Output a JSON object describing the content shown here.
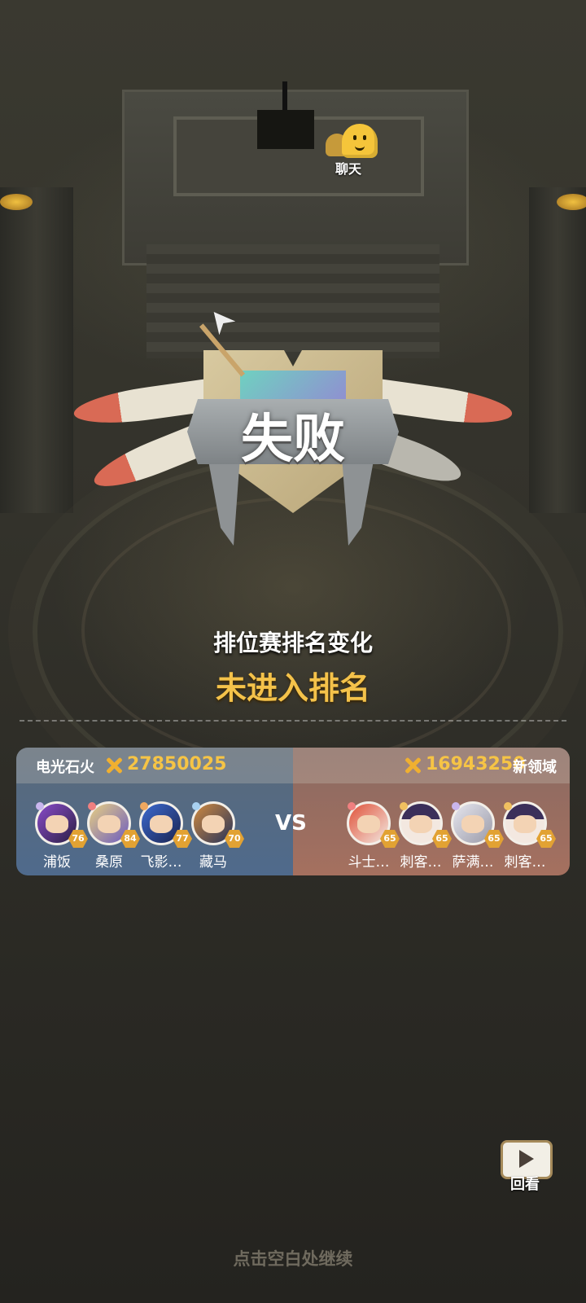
{
  "chat": {
    "label": "聊天",
    "icon": "chat-ghost-icon"
  },
  "result": {
    "title": "失败"
  },
  "rank": {
    "label": "排位赛排名变化",
    "value": "未进入排名"
  },
  "match": {
    "left_team": {
      "name": "电光石火",
      "score": "27850025",
      "color": "#4f6a8c",
      "players": [
        {
          "name": "浦饭",
          "level": "76",
          "avatar_color": "#6a3c9c"
        },
        {
          "name": "桑原",
          "level": "84",
          "avatar_color": "#c9b07a"
        },
        {
          "name": "飞影…",
          "level": "77",
          "avatar_color": "#2f4fa8"
        },
        {
          "name": "藏马",
          "level": "70",
          "avatar_color": "#3a4f7a"
        }
      ]
    },
    "vs_label": "VS",
    "right_team": {
      "name": "新领域",
      "score": "16943250",
      "color": "#a5705f",
      "players": [
        {
          "name": "斗士…",
          "level": "65",
          "avatar_color": "#c8452f"
        },
        {
          "name": "刺客…",
          "level": "65",
          "avatar_color": "#3b2f5a"
        },
        {
          "name": "萨满…",
          "level": "65",
          "avatar_color": "#cfcfd6"
        },
        {
          "name": "刺客…",
          "level": "65",
          "avatar_color": "#3b2f5a"
        }
      ]
    }
  },
  "replay": {
    "label": "回看",
    "icon": "replay-video-icon"
  },
  "continue_hint": "点击空白处继续",
  "colors": {
    "accent_gold": "#f4c24a",
    "level_badge": "#e2a233"
  }
}
